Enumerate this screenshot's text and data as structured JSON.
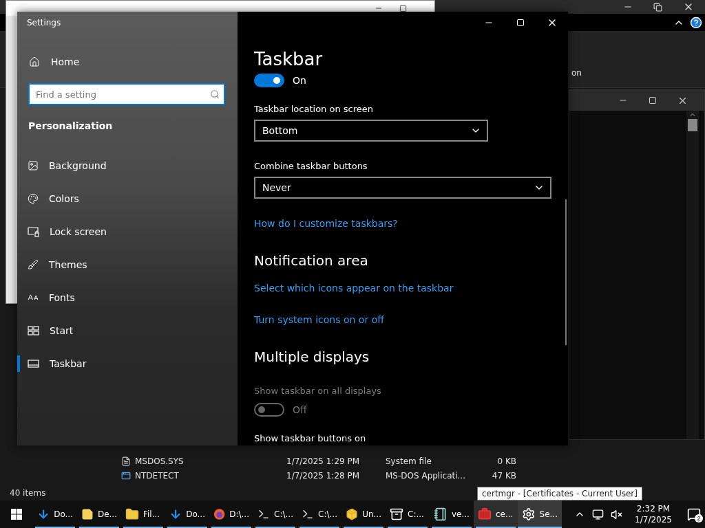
{
  "explorer": {
    "ribbon_text": "on",
    "files": [
      {
        "name": "MSDOS.SYS",
        "modified": "1/7/2025 1:29 PM",
        "type": "System file",
        "size": "0 KB",
        "kind": "document"
      },
      {
        "name": "NTDETECT",
        "modified": "1/7/2025 1:28 PM",
        "type": "MS-DOS Applicati...",
        "size": "47 KB",
        "kind": "program"
      }
    ],
    "status": "40 items"
  },
  "tooltip": "certmgr - [Certificates - Current User]",
  "settings": {
    "title": "Settings",
    "home": "Home",
    "search": {
      "placeholder": "Find a setting"
    },
    "section": "Personalization",
    "nav": [
      {
        "label": "Background",
        "kind": "background",
        "selected": false
      },
      {
        "label": "Colors",
        "kind": "colors",
        "selected": false
      },
      {
        "label": "Lock screen",
        "kind": "lock",
        "selected": false
      },
      {
        "label": "Themes",
        "kind": "themes",
        "selected": false
      },
      {
        "label": "Fonts",
        "kind": "fonts",
        "selected": false
      },
      {
        "label": "Start",
        "kind": "start",
        "selected": false
      },
      {
        "label": "Taskbar",
        "kind": "taskbar",
        "selected": true
      }
    ],
    "page_title": "Taskbar",
    "content": [
      {
        "kind": "toggle",
        "label": "On",
        "on": true,
        "disabled": false
      },
      {
        "kind": "label",
        "text": "Taskbar location on screen"
      },
      {
        "kind": "dropdown",
        "value": "Bottom",
        "wide": false
      },
      {
        "kind": "label",
        "text": "Combine taskbar buttons"
      },
      {
        "kind": "dropdown",
        "value": "Never",
        "wide": true
      },
      {
        "kind": "link",
        "text": "How do I customize taskbars?"
      },
      {
        "kind": "heading",
        "text": "Notification area"
      },
      {
        "kind": "link",
        "text": "Select which icons appear on the taskbar"
      },
      {
        "kind": "link",
        "text": "Turn system icons on or off"
      },
      {
        "kind": "heading",
        "text": "Multiple displays"
      },
      {
        "kind": "label",
        "text": "Show taskbar on all displays",
        "disabled": true
      },
      {
        "kind": "toggle",
        "label": "Off",
        "on": false,
        "disabled": true
      },
      {
        "kind": "label",
        "text": "Show taskbar buttons on"
      }
    ]
  },
  "taskbar": {
    "items": [
      {
        "label": "Do...",
        "kind": "download",
        "selected": false,
        "hovered": false
      },
      {
        "label": "De...",
        "kind": "note",
        "selected": false,
        "hovered": false
      },
      {
        "label": "Fil...",
        "kind": "folder",
        "selected": false,
        "hovered": false
      },
      {
        "label": "Do...",
        "kind": "download",
        "selected": false,
        "hovered": false
      },
      {
        "label": "D:\\...",
        "kind": "browser",
        "selected": false,
        "hovered": false
      },
      {
        "label": "C:\\...",
        "kind": "console",
        "selected": false,
        "hovered": false
      },
      {
        "label": "C:\\...",
        "kind": "console",
        "selected": false,
        "hovered": false
      },
      {
        "label": "Un...",
        "kind": "package",
        "selected": false,
        "hovered": false
      },
      {
        "label": "C:...",
        "kind": "archive",
        "selected": false,
        "hovered": false
      },
      {
        "label": "ve...",
        "kind": "notebook",
        "selected": false,
        "hovered": false
      },
      {
        "label": "ce...",
        "kind": "toolbox",
        "selected": false,
        "hovered": true
      },
      {
        "label": "Se...",
        "kind": "gear",
        "selected": true,
        "hovered": false
      }
    ],
    "time": "2:32 PM",
    "date": "1/7/2025",
    "notifications": "2"
  }
}
